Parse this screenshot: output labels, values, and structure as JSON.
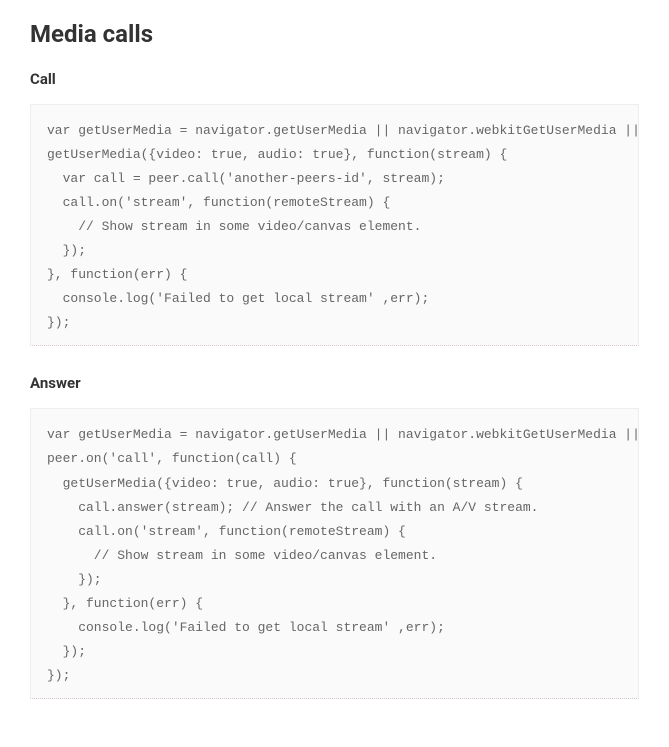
{
  "heading": "Media calls",
  "sections": {
    "call": {
      "title": "Call",
      "code": "var getUserMedia = navigator.getUserMedia || navigator.webkitGetUserMedia || navigator.mozGetUserMedia;\ngetUserMedia({video: true, audio: true}, function(stream) {\n  var call = peer.call('another-peers-id', stream);\n  call.on('stream', function(remoteStream) {\n    // Show stream in some video/canvas element.\n  });\n}, function(err) {\n  console.log('Failed to get local stream' ,err);\n});"
    },
    "answer": {
      "title": "Answer",
      "code": "var getUserMedia = navigator.getUserMedia || navigator.webkitGetUserMedia || navigator.mozGetUserMedia;\npeer.on('call', function(call) {\n  getUserMedia({video: true, audio: true}, function(stream) {\n    call.answer(stream); // Answer the call with an A/V stream.\n    call.on('stream', function(remoteStream) {\n      // Show stream in some video/canvas element.\n    });\n  }, function(err) {\n    console.log('Failed to get local stream' ,err);\n  });\n});"
    }
  }
}
